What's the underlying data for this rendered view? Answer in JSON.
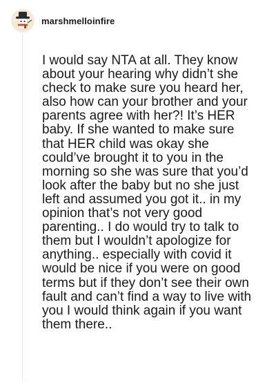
{
  "post": {
    "username": "marshmelloinfire",
    "avatar_icon": "marshmallow-character-avatar-icon",
    "text": "I would say NTA at all. They know about your hearing why didn’t she check to make sure you heard her, also how can your brother and your parents agree with her?! It’s HER baby. If she wanted to make sure that HER child was okay she could’ve brought it to you in the morning so she was sure that you’d look after the baby but no she just left and assumed you got it.. in my opinion that’s not very good parenting.. I do would try to talk to them but I wouldn’t apologize for anything.. especially with covid it would be nice if you were on good terms but if they don’t see their own fault and can’t find a way to live with you I would think again if you want them there.."
  },
  "colors": {
    "avatar_bg": "#f5e9d8",
    "hat": "#2b2b33",
    "thread_line": "#e3e3e3"
  }
}
